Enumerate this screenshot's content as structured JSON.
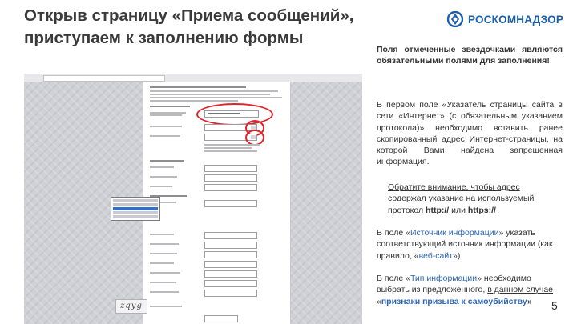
{
  "slide": {
    "title": "Открыв страницу «Приема сообщений», приступаем к заполнению формы",
    "logo_text": "РОСКОМНАДЗОР",
    "page_number": "5",
    "colors": {
      "accent_blue": "#2d66b8",
      "logo_blue": "#1d5fa7",
      "highlight_red": "#e0242a",
      "text": "#333333"
    }
  },
  "notes": {
    "required": "Поля отмеченные звездочками являются обязательными полями для заполнения!",
    "url_a": "В первом поле «Указатель страницы сайта в сети «Интернет» (с обязательным указанием протокола)» необходимо вставить ранее скопированный адрес Интернет-страницы, на которой Вами найдена запрещенная информация.",
    "attention_a": "Обратите внимание, чтобы адрес содержал указание на используемый протокол",
    "attention_b": "http://",
    "attention_c": "или",
    "attention_d": "https://",
    "source_a": "В поле «",
    "source_b": "Источник информации",
    "source_c": "» указать соответствующий источник информации (как правило, «",
    "source_d": "веб-сайт",
    "source_e": "»)",
    "type_a": "В поле «",
    "type_b": "Тип информации",
    "type_c": "» необходимо выбрать из предложенного, ",
    "type_d": "в данном случае",
    "type_e": " «",
    "type_f": "признаки призыва к самоубийству",
    "type_g": "»"
  },
  "screenshot": {
    "captcha_text": "zqyg"
  }
}
